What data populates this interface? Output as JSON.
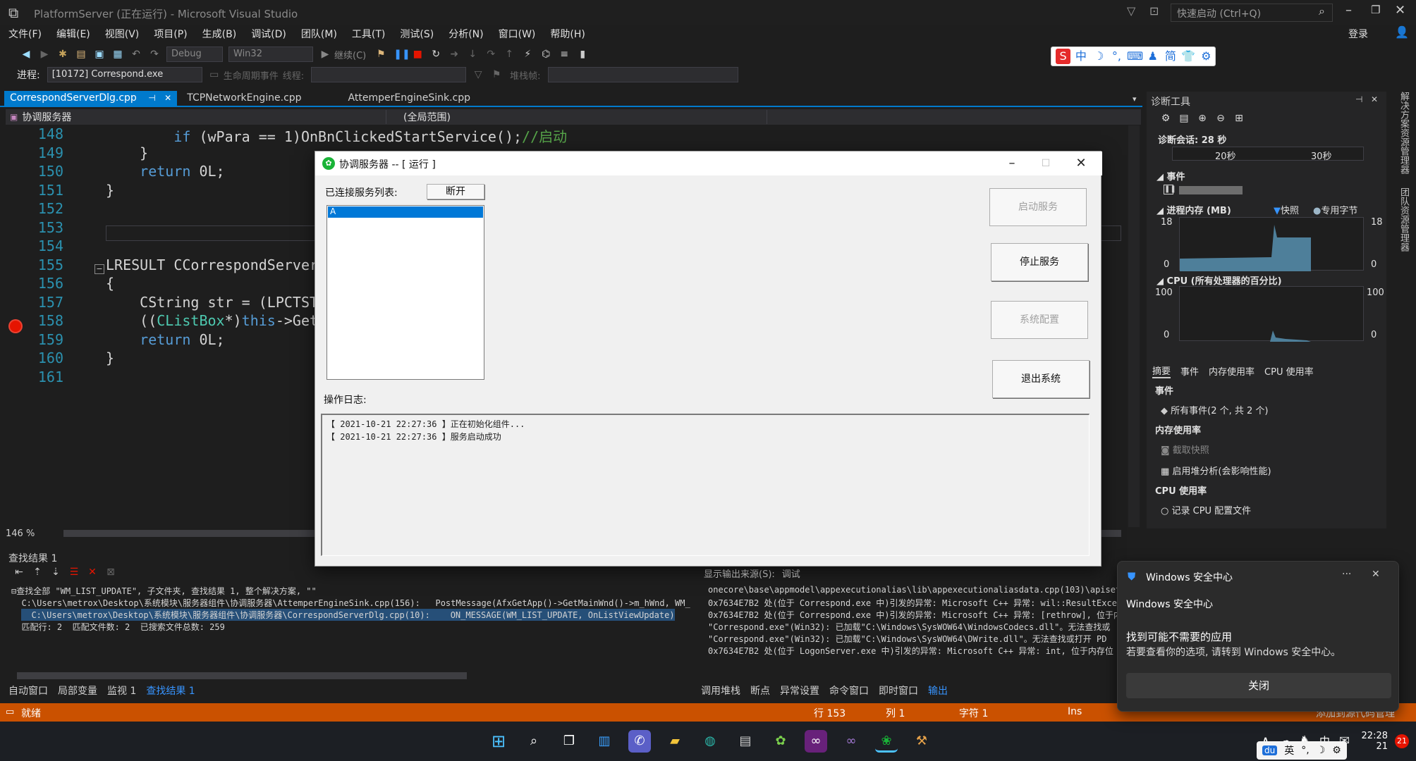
{
  "window": {
    "title": "PlatformServer (正在运行) - Microsoft Visual Studio",
    "quick_launch_placeholder": "快速启动 (Ctrl+Q)",
    "login": "登录"
  },
  "menu": [
    "文件(F)",
    "编辑(E)",
    "视图(V)",
    "项目(P)",
    "生成(B)",
    "调试(D)",
    "团队(M)",
    "工具(T)",
    "测试(S)",
    "分析(N)",
    "窗口(W)",
    "帮助(H)"
  ],
  "toolbar": {
    "config": "Debug",
    "platform": "Win32",
    "continue_label": "继续(C)",
    "process_label": "进程:",
    "process_value": "[10172] Correspond.exe",
    "lifecycle_label": "生命周期事件",
    "thread_label": "线程:",
    "stackframe_label": "堆栈帧:"
  },
  "ime": [
    "中",
    "简"
  ],
  "doc_tabs": [
    "CorrespondServerDlg.cpp",
    "TCPNetworkEngine.cpp",
    "AttemperEngineSink.cpp"
  ],
  "nav": {
    "class": "协调服务器",
    "scope": "(全局范围)"
  },
  "code": [
    {
      "ln": "148",
      "parts": [
        [
          "",
          "        "
        ],
        [
          "kw",
          "if"
        ],
        [
          "",
          " (wPara == 1)OnBnClickedStartService();"
        ],
        [
          "cm",
          "//启动"
        ]
      ]
    },
    {
      "ln": "149",
      "parts": [
        [
          "",
          "    }"
        ]
      ]
    },
    {
      "ln": "150",
      "parts": [
        [
          "",
          "    "
        ],
        [
          "kw",
          "return"
        ],
        [
          "",
          " 0L;"
        ]
      ]
    },
    {
      "ln": "151",
      "parts": [
        [
          "",
          "}"
        ]
      ]
    },
    {
      "ln": "152",
      "parts": []
    },
    {
      "ln": "153",
      "parts": []
    },
    {
      "ln": "154",
      "parts": []
    },
    {
      "ln": "155",
      "parts": [
        [
          "",
          "LRESULT CCorrespondServerDl"
        ]
      ]
    },
    {
      "ln": "156",
      "parts": [
        [
          "",
          "{"
        ]
      ]
    },
    {
      "ln": "157",
      "parts": [
        [
          "",
          "    CString str = (LPCTSTR)"
        ]
      ]
    },
    {
      "ln": "158",
      "parts": [
        [
          "",
          "    (("
        ],
        [
          "ty",
          "CListBox"
        ],
        [
          "",
          "*)"
        ],
        [
          "kw",
          "this"
        ],
        [
          "",
          "->GetDl"
        ]
      ]
    },
    {
      "ln": "159",
      "parts": [
        [
          "",
          "    "
        ],
        [
          "kw",
          "return"
        ],
        [
          "",
          " 0L;"
        ]
      ]
    },
    {
      "ln": "160",
      "parts": [
        [
          "",
          "}"
        ]
      ]
    },
    {
      "ln": "161",
      "parts": []
    }
  ],
  "zoom": "146 %",
  "diag": {
    "title": "诊断工具",
    "session": "诊断会话: 28 秒",
    "t1": "20秒",
    "t2": "30秒",
    "events": "事件",
    "memory": "进程内存 (MB)",
    "snapshot": "快照",
    "private_bytes": "专用字节",
    "mem_max": "18",
    "mem_min": "0",
    "cpu": "CPU (所有处理器的百分比)",
    "cpu_max": "100",
    "cpu_min": "0",
    "tabs": [
      "摘要",
      "事件",
      "内存使用率",
      "CPU 使用率"
    ],
    "sec_events": "事件",
    "all_events": "所有事件(2 个, 共 2 个)",
    "sec_mem": "内存使用率",
    "take_snapshot": "截取快照",
    "heap_analysis": "启用堆分析(会影响性能)",
    "sec_cpu": "CPU 使用率",
    "record_cpu": "记录 CPU 配置文件"
  },
  "side_tabs": [
    "解决方案资源管理器",
    "团队资源管理器"
  ],
  "find": {
    "title": "查找结果 1",
    "lines": [
      "⊟查找全部 \"WM_LIST_UPDATE\", 子文件夹, 查找结果 1, 整个解决方案, \"\"",
      "  C:\\Users\\metrox\\Desktop\\系统模块\\服务器组件\\协调服务器\\AttemperEngineSink.cpp(156):   PostMessage(AfxGetApp()->GetMainWnd()->m_hWnd, WM_",
      "  C:\\Users\\metrox\\Desktop\\系统模块\\服务器组件\\协调服务器\\CorrespondServerDlg.cpp(10):    ON_MESSAGE(WM_LIST_UPDATE, OnListViewUpdate)",
      "  匹配行: 2  匹配文件数: 2  已搜索文件总数: 259"
    ],
    "tabs": [
      "自动窗口",
      "局部变量",
      "监视 1",
      "查找结果 1"
    ]
  },
  "output": {
    "source_label": "显示输出来源(S):",
    "source_value": "调试",
    "lines": [
      "onecore\\base\\appmodel\\appexecutionalias\\lib\\appexecutionaliasdata.cpp(103)\\apisethost.",
      "0x7634E7B2 处(位于 Correspond.exe 中)引发的异常: Microsoft C++ 异常: wil::ResultExcept",
      "0x7634E7B2 处(位于 Correspond.exe 中)引发的异常: Microsoft C++ 异常: [rethrow], 位于内",
      "\"Correspond.exe\"(Win32): 已加载\"C:\\Windows\\SysWOW64\\WindowsCodecs.dll\"。无法查找或",
      "\"Correspond.exe\"(Win32): 已加载\"C:\\Windows\\SysWOW64\\DWrite.dll\"。无法查找或打开 PD",
      "0x7634E7B2 处(位于 LogonServer.exe 中)引发的异常: Microsoft C++ 异常: int, 位于内存位"
    ],
    "tabs": [
      "调用堆栈",
      "断点",
      "异常设置",
      "命令窗口",
      "即时窗口",
      "输出"
    ]
  },
  "status": {
    "ready": "就绪",
    "line": "行 153",
    "col": "列 1",
    "char": "字符 1",
    "ins": "Ins",
    "source_control": "添加到源代码管理"
  },
  "tray": {
    "lang": "中",
    "ime": "英",
    "time": "22:28",
    "date": "21",
    "badge": "21"
  },
  "dialog": {
    "title": "协调服务器 -- [ 运行 ]",
    "connected_label": "已连接服务列表:",
    "disconnect": "断开",
    "list_item": "A",
    "log_label": "操作日志:",
    "log": [
      "【 2021-10-21 22:27:36 】正在初始化组件...",
      "【 2021-10-21 22:27:36 】服务启动成功"
    ],
    "btn_start": "启动服务",
    "btn_stop": "停止服务",
    "btn_config": "系统配置",
    "btn_exit": "退出系统"
  },
  "toast": {
    "app": "Windows 安全中心",
    "source": "Windows 安全中心",
    "heading": "找到可能不需要的应用",
    "body": "若要查看你的选项, 请转到 Windows 安全中心。",
    "close": "关闭"
  },
  "colors": {
    "accent": "#007acc",
    "status_bar": "#ca5100",
    "breakpoint": "#e51400"
  }
}
